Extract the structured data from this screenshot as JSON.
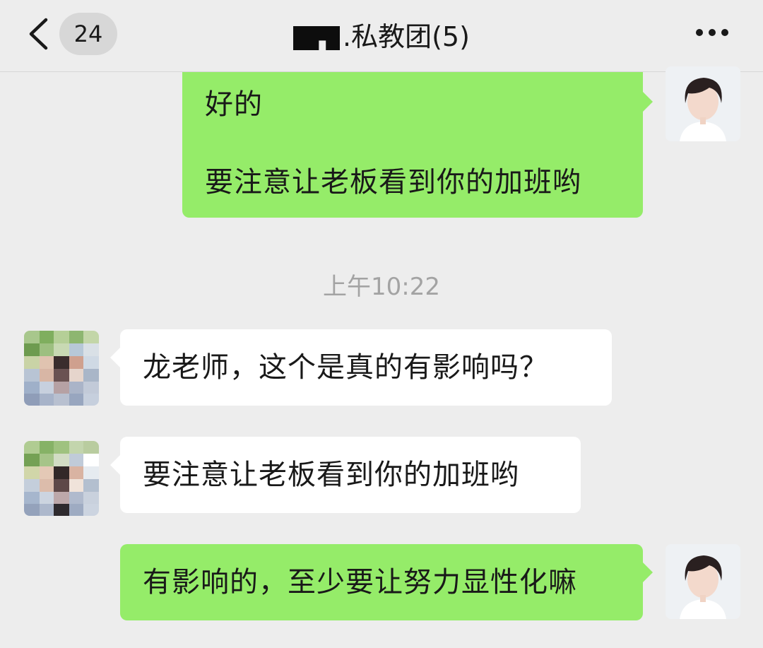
{
  "header": {
    "unread_count": "24",
    "title": ".私教团(5)",
    "back_icon": "chevron-left-icon",
    "more_icon": "more-dots-icon"
  },
  "messages": [
    {
      "direction": "outgoing",
      "lines": [
        "好的",
        "要注意让老板看到你的加班哟"
      ]
    },
    {
      "direction": "incoming",
      "text": "龙老师，这个是真的有影响吗？"
    },
    {
      "direction": "incoming",
      "text": "要注意让老板看到你的加班哟"
    },
    {
      "direction": "outgoing",
      "text": "有影响的，至少要让努力显性化嘛"
    }
  ],
  "timestamp": "上午10:22",
  "colors": {
    "background": "#ededed",
    "outgoing_bubble": "#95ec69",
    "incoming_bubble": "#ffffff",
    "timestamp_text": "#a3a3a3"
  }
}
